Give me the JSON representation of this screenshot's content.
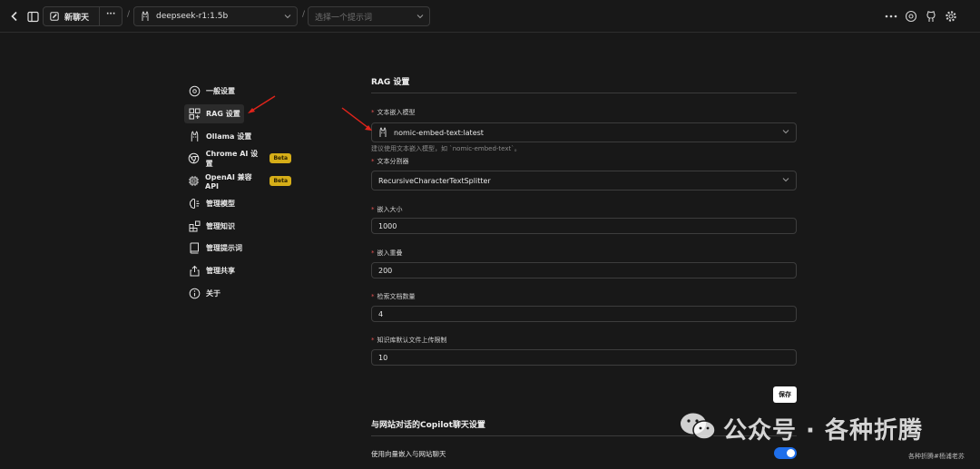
{
  "topbar": {
    "new_chat_label": "新聊天",
    "more_label": "···",
    "sep1": "/",
    "sep2": "/",
    "model_name": "deepseek-r1:1.5b",
    "prompt_placeholder": "选择一个提示词"
  },
  "sidebar": {
    "items": [
      {
        "label": "一般设置",
        "icon": "gear-cycle-icon"
      },
      {
        "label": "RAG 设置",
        "icon": "rag-grid-icon",
        "active": true
      },
      {
        "label": "Ollama 设置",
        "icon": "ollama-icon"
      },
      {
        "label": "Chrome AI 设置",
        "icon": "chrome-icon",
        "badge": "Beta"
      },
      {
        "label": "OpenAI 兼容 API",
        "icon": "chip-icon",
        "badge": "Beta"
      },
      {
        "label": "管理模型",
        "icon": "brain-icon"
      },
      {
        "label": "管理知识",
        "icon": "blocks-icon"
      },
      {
        "label": "管理提示词",
        "icon": "book-icon"
      },
      {
        "label": "管理共享",
        "icon": "share-icon"
      },
      {
        "label": "关于",
        "icon": "info-icon"
      }
    ]
  },
  "rag": {
    "title": "RAG 设置",
    "embed_model_label": "文本嵌入模型",
    "embed_model_value": "nomic-embed-text:latest",
    "embed_hint": "建议使用文本嵌入模型，如 `nomic-embed-text`。",
    "splitter_label": "文本分割器",
    "splitter_value": "RecursiveCharacterTextSplitter",
    "chunk_size_label": "嵌入大小",
    "chunk_size_value": "1000",
    "chunk_overlap_label": "嵌入重叠",
    "chunk_overlap_value": "200",
    "retrieval_count_label": "检索文档数量",
    "retrieval_count_value": "4",
    "upload_limit_label": "知识库默认文件上传限制",
    "upload_limit_value": "10",
    "required_mark": "*",
    "save_label": "保存"
  },
  "copilot": {
    "title": "与网站对话的Copilot聊天设置",
    "vector_toggle_label": "使用向量嵌入与网站聊天",
    "vector_toggle_on": true
  },
  "watermark": {
    "main": "公众号 · 各种折腾",
    "sub": "各种折腾#杨浦老苏"
  },
  "colors": {
    "accent": "#1f6feb",
    "badge": "#d6ae18",
    "required": "#e05252",
    "arrow": "#e0241b"
  }
}
